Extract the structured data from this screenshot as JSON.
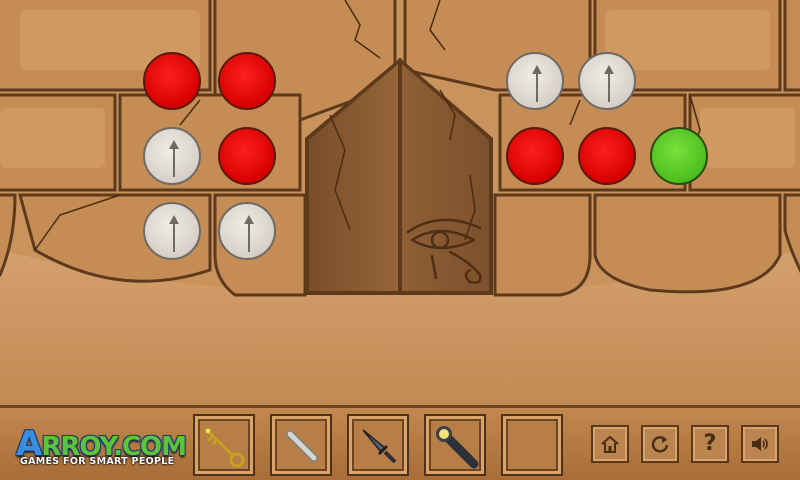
{
  "logo": {
    "main_a": "A",
    "main_rest": "RROY.COM",
    "tagline": "GAMES FOR SMART PEOPLE"
  },
  "puzzle": {
    "left_grid": [
      [
        "red",
        "red"
      ],
      [
        "gray",
        "red"
      ],
      [
        "gray",
        "gray"
      ]
    ],
    "right_grid": [
      [
        "gray",
        "gray",
        null
      ],
      [
        "red",
        "red",
        "green"
      ]
    ]
  },
  "inventory": [
    {
      "name": "golden-key",
      "icon": "key-icon"
    },
    {
      "name": "metal-rod",
      "icon": "rod-icon"
    },
    {
      "name": "dagger",
      "icon": "dagger-icon"
    },
    {
      "name": "flashlight",
      "icon": "flashlight-icon"
    },
    {
      "name": "empty",
      "icon": null
    }
  ],
  "buttons": [
    {
      "name": "home-button",
      "icon": "home-icon"
    },
    {
      "name": "restart-button",
      "icon": "restart-icon"
    },
    {
      "name": "help-button",
      "icon": "question-icon",
      "label": "?"
    },
    {
      "name": "sound-button",
      "icon": "speaker-icon"
    }
  ],
  "colors": {
    "red": "#e00000",
    "green": "#5cc925",
    "gray": "#d9d4cc",
    "stone": "#c9935e",
    "door": "#8a5a33"
  }
}
